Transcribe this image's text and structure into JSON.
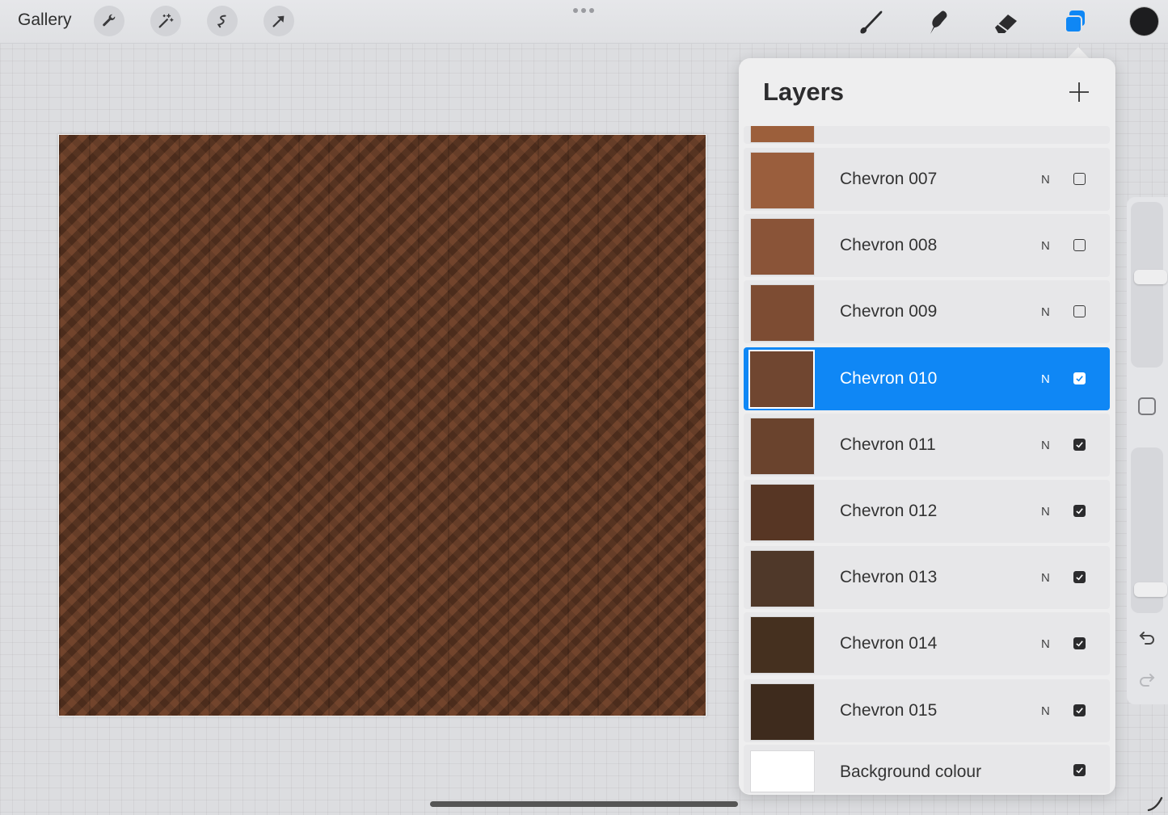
{
  "topbar": {
    "gallery_label": "Gallery",
    "left_tools": [
      "wrench-icon",
      "magic-wand-icon",
      "selection-icon",
      "transform-arrow-icon"
    ],
    "right_tools": [
      "brush-icon",
      "smudge-icon",
      "eraser-icon",
      "layers-icon"
    ],
    "active_tool": "layers-icon",
    "current_color": "#1d1d1f",
    "accent_color": "#0f87f5"
  },
  "layers_panel": {
    "title": "Layers",
    "add_icon": "plus-icon",
    "partial_top_layer": {
      "thumb_color": "#9c5f3b"
    },
    "layers": [
      {
        "name": "Chevron 007",
        "mode": "N",
        "visible": false,
        "selected": false,
        "thumb_color": "#9a5e3d"
      },
      {
        "name": "Chevron 008",
        "mode": "N",
        "visible": false,
        "selected": false,
        "thumb_color": "#8a5438"
      },
      {
        "name": "Chevron 009",
        "mode": "N",
        "visible": false,
        "selected": false,
        "thumb_color": "#7d4c33"
      },
      {
        "name": "Chevron 010",
        "mode": "N",
        "visible": true,
        "selected": true,
        "thumb_color": "#704630"
      },
      {
        "name": "Chevron 011",
        "mode": "N",
        "visible": true,
        "selected": false,
        "thumb_color": "#6a432d"
      },
      {
        "name": "Chevron 012",
        "mode": "N",
        "visible": true,
        "selected": false,
        "thumb_color": "#573624"
      },
      {
        "name": "Chevron 013",
        "mode": "N",
        "visible": true,
        "selected": false,
        "thumb_color": "#4f3829"
      },
      {
        "name": "Chevron 014",
        "mode": "N",
        "visible": true,
        "selected": false,
        "thumb_color": "#45301f"
      },
      {
        "name": "Chevron 015",
        "mode": "N",
        "visible": true,
        "selected": false,
        "thumb_color": "#3e2b1d"
      }
    ],
    "background": {
      "name": "Background colour",
      "visible": true,
      "thumb_color": "#ffffff"
    }
  },
  "sidebar": {
    "size_slider_level": 0.55,
    "opacity_slider_level": 0.95,
    "undo_icon": "undo-icon",
    "redo_icon": "redo-icon",
    "modify_icon": "square-modify-icon"
  }
}
